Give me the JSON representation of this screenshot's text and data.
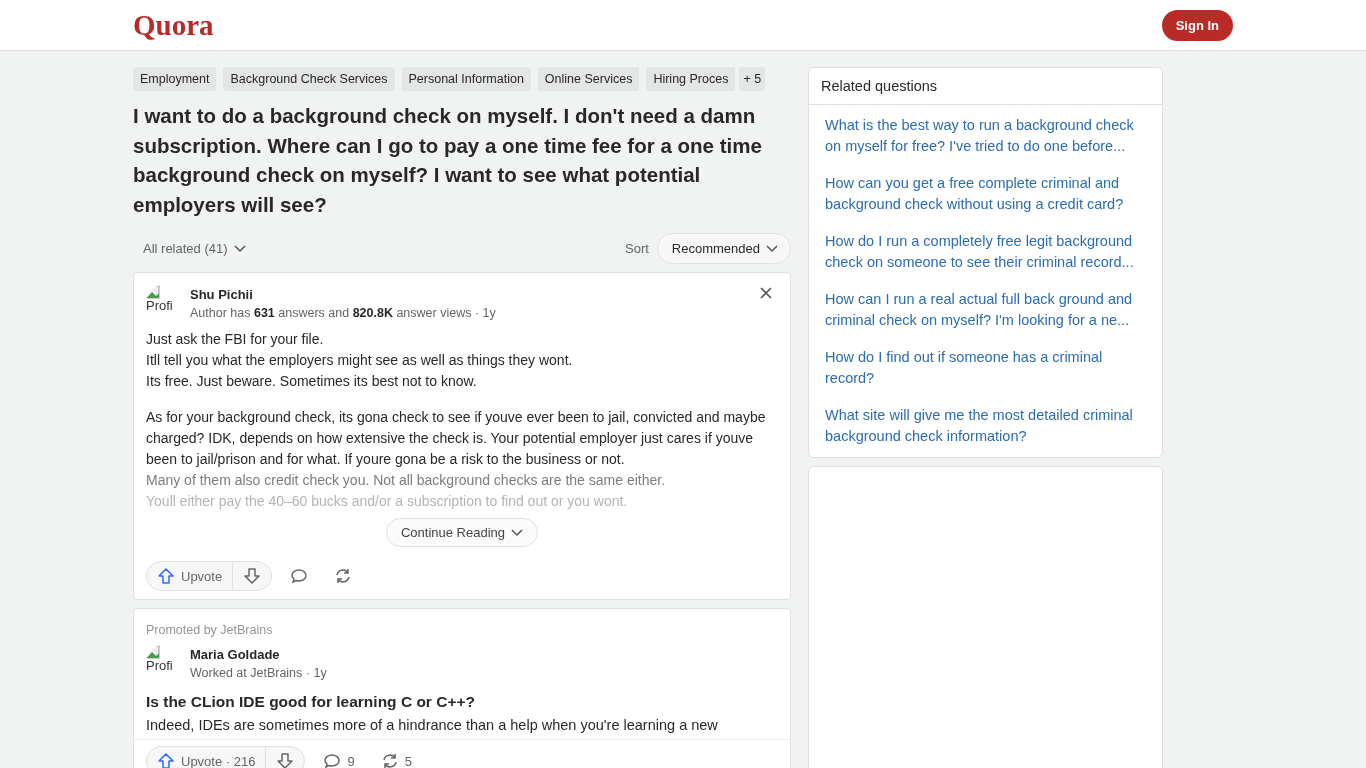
{
  "header": {
    "logo": "Quora",
    "sign_in": "Sign In"
  },
  "topics": [
    {
      "label": "Employment"
    },
    {
      "label": "Background Check Services"
    },
    {
      "label": "Personal Information"
    },
    {
      "label": "Online Services"
    },
    {
      "label": "Hiring Proces"
    }
  ],
  "more_topics": "+ 5",
  "question": "I want to do a background check on myself. I don't need a damn subscription. Where can I go to pay a one time fee for a one time background check on myself? I want to see what potential employers will see?",
  "filter": {
    "label": "All related (41)",
    "sort_label": "Sort",
    "sort_value": "Recommended"
  },
  "answer": {
    "avatar_alt": "Profi",
    "author": "Shu Pichii",
    "meta": "Author has **631** answers and **820.8K** answer views · 1y",
    "paragraphs": [
      [
        "Just ask the FBI for your file.",
        "Itll tell you what the employers might see as well as things they wont.",
        "Its free. Just beware. Sometimes its best not to know."
      ],
      [
        "As for your background check, its gona check to see if youve ever been to jail, convicted and maybe charged? IDK, depends on how extensive the check is. Your potential employer just cares if youve been to jail/prison and for what. If youre gona be a risk to the business or not.",
        "Many of them also credit check you. Not all background checks are the same either.",
        "Youll either pay the 40–60 bucks and/or a subscription to find out or you wont."
      ]
    ],
    "continue": "Continue Reading",
    "upvote": "Upvote"
  },
  "promoted": {
    "label": "Promoted by JetBrains",
    "avatar_alt": "Profi",
    "author": "Maria Goldade",
    "meta": "Worked at JetBrains · 1y",
    "title": "Is the CLion IDE good for learning C or C++?",
    "excerpt": "Indeed, IDEs are sometimes more of a hindrance than a help when you're learning a new",
    "upvote": "Upvote · 216",
    "comments": "9",
    "shares": "5"
  },
  "related": {
    "title": "Related questions",
    "items": [
      {
        "text": "What is the best way to run a background check on myself for free? I've tried to do one before..."
      },
      {
        "text": "How can you get a free complete criminal and background check without using a credit card?"
      },
      {
        "text": "How do I run a completely free legit background check on someone to see their criminal record..."
      },
      {
        "text": "How can I run a real actual full back ground and criminal check on myself? I'm looking for a ne..."
      },
      {
        "text": "How do I find out if someone has a criminal record?"
      },
      {
        "text": "What site will give me the most detailed criminal background check information?"
      }
    ]
  }
}
